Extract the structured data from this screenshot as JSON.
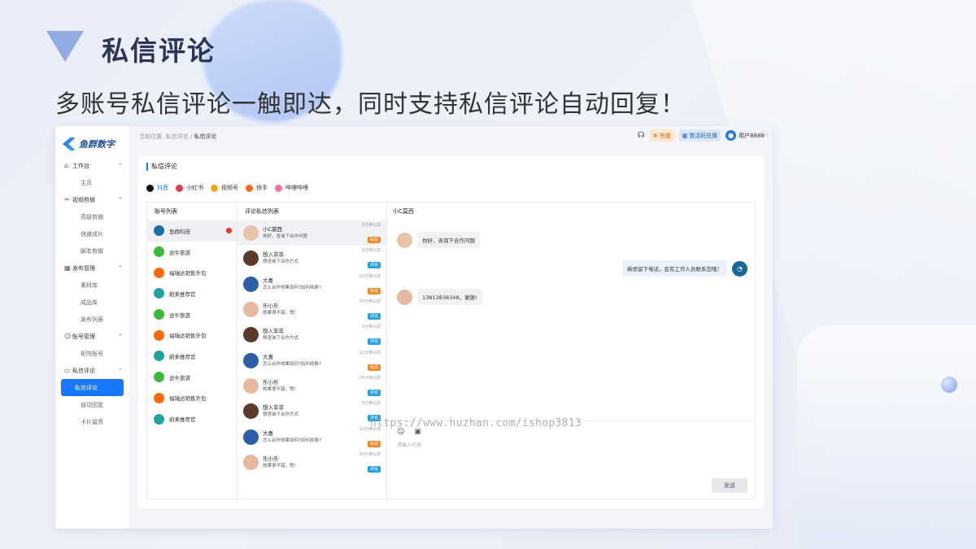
{
  "slide": {
    "title": "私信评论",
    "subtitle": "多账号私信评论一触即达，同时支持私信评论自动回复！",
    "watermark": "https://www.huzhan.com/ishop3813"
  },
  "app": {
    "brand": "鱼群数字",
    "breadcrumb": {
      "prefix": "当前位置:",
      "parent": "私信评论",
      "sep": "/",
      "current": "私信评论"
    },
    "topbar": {
      "recharge": "充值",
      "activate": "激活码兑换",
      "username": "用户8888"
    },
    "nav": [
      {
        "label": "工作台",
        "icon": "⌂",
        "children": [
          "主页"
        ]
      },
      {
        "label": "视频剪辑",
        "icon": "✂",
        "children": [
          "高级剪辑",
          "快速成片",
          "脚本剪辑"
        ]
      },
      {
        "label": "发布管理",
        "icon": "▦",
        "children": [
          "素材库",
          "成品库",
          "发布列表"
        ]
      },
      {
        "label": "账号管理",
        "icon": "☺",
        "children": [
          "矩阵账号"
        ]
      },
      {
        "label": "私信评论",
        "icon": "▭",
        "children": [
          "私信评论",
          "自动回复",
          "卡片留资"
        ]
      }
    ],
    "card_title": "私信评论",
    "tabs": [
      {
        "label": "抖音",
        "color": "#111"
      },
      {
        "label": "小红书",
        "color": "#e8374a"
      },
      {
        "label": "视频号",
        "color": "#f4a020"
      },
      {
        "label": "快手",
        "color": "#ff6a1a"
      },
      {
        "label": "哔哩哔哩",
        "color": "#f46fa5"
      }
    ],
    "accounts_header": "账号列表",
    "accounts": [
      {
        "name": "鱼群科技",
        "color": "#1b6ea7"
      },
      {
        "name": "途牛旅游",
        "color": "#3cba3c"
      },
      {
        "name": "福瑞达销售外包",
        "color": "#ff6a00"
      },
      {
        "name": "蔚来推荐官",
        "color": "#23a3a0"
      },
      {
        "name": "途牛旅游",
        "color": "#3cba3c"
      },
      {
        "name": "福瑞达销售外包",
        "color": "#ff6a00"
      },
      {
        "name": "蔚来推荐官",
        "color": "#23a3a0"
      },
      {
        "name": "途牛旅游",
        "color": "#3cba3c"
      },
      {
        "name": "福瑞达销售外包",
        "color": "#ff6a00"
      },
      {
        "name": "蔚来推荐官",
        "color": "#23a3a0"
      }
    ],
    "messages_header": "评论私信列表",
    "messages": [
      {
        "name": "小C莫西",
        "text": "你好，咨询下合作问题",
        "time": "6分钟以前",
        "tag": "私信",
        "av": "#e9c4a8"
      },
      {
        "name": "想入非非",
        "text": "想咨询下合作方式",
        "time": "5分钟以前",
        "tag": "评论",
        "av": "#5a3a2a"
      },
      {
        "name": "大喜",
        "text": "怎么合作效果如何?如何收费?",
        "time": "12分钟以前",
        "tag": "私信",
        "av": "#2c5fa8"
      },
      {
        "name": "乐小乐",
        "text": "效果很不错，赞!",
        "time": "25分钟以前",
        "tag": "评论",
        "av": "#e7b9a0"
      },
      {
        "name": "想入非非",
        "text": "想咨询下合作方式",
        "time": "5分钟以前",
        "tag": "评论",
        "av": "#5a3a2a"
      },
      {
        "name": "大喜",
        "text": "怎么合作效果如何?如何收费?",
        "time": "12分钟以前",
        "tag": "私信",
        "av": "#2c5fa8"
      },
      {
        "name": "乐小乐",
        "text": "效果很不错，赞!",
        "time": "25分钟以前",
        "tag": "评论",
        "av": "#e7b9a0"
      },
      {
        "name": "想入非非",
        "text": "想咨询下合作方式",
        "time": "5分钟以前",
        "tag": "评论",
        "av": "#5a3a2a"
      },
      {
        "name": "大喜",
        "text": "怎么合作效果如何?如何收费?",
        "time": "12分钟以前",
        "tag": "私信",
        "av": "#2c5fa8"
      },
      {
        "name": "乐小乐",
        "text": "效果很不错，赞!",
        "time": "25分钟以前",
        "tag": "评论",
        "av": "#e7b9a0"
      }
    ],
    "chat": {
      "title": "小C莫西",
      "bubbles": [
        {
          "text": "你好，咨询下合作问题",
          "side": "left"
        },
        {
          "text": "麻烦留下电话，会有工作人员联系您哦！",
          "side": "right"
        },
        {
          "text": "13813838348，谢谢!",
          "side": "left"
        }
      ],
      "placeholder": "请输入内容",
      "send": "发送"
    }
  }
}
